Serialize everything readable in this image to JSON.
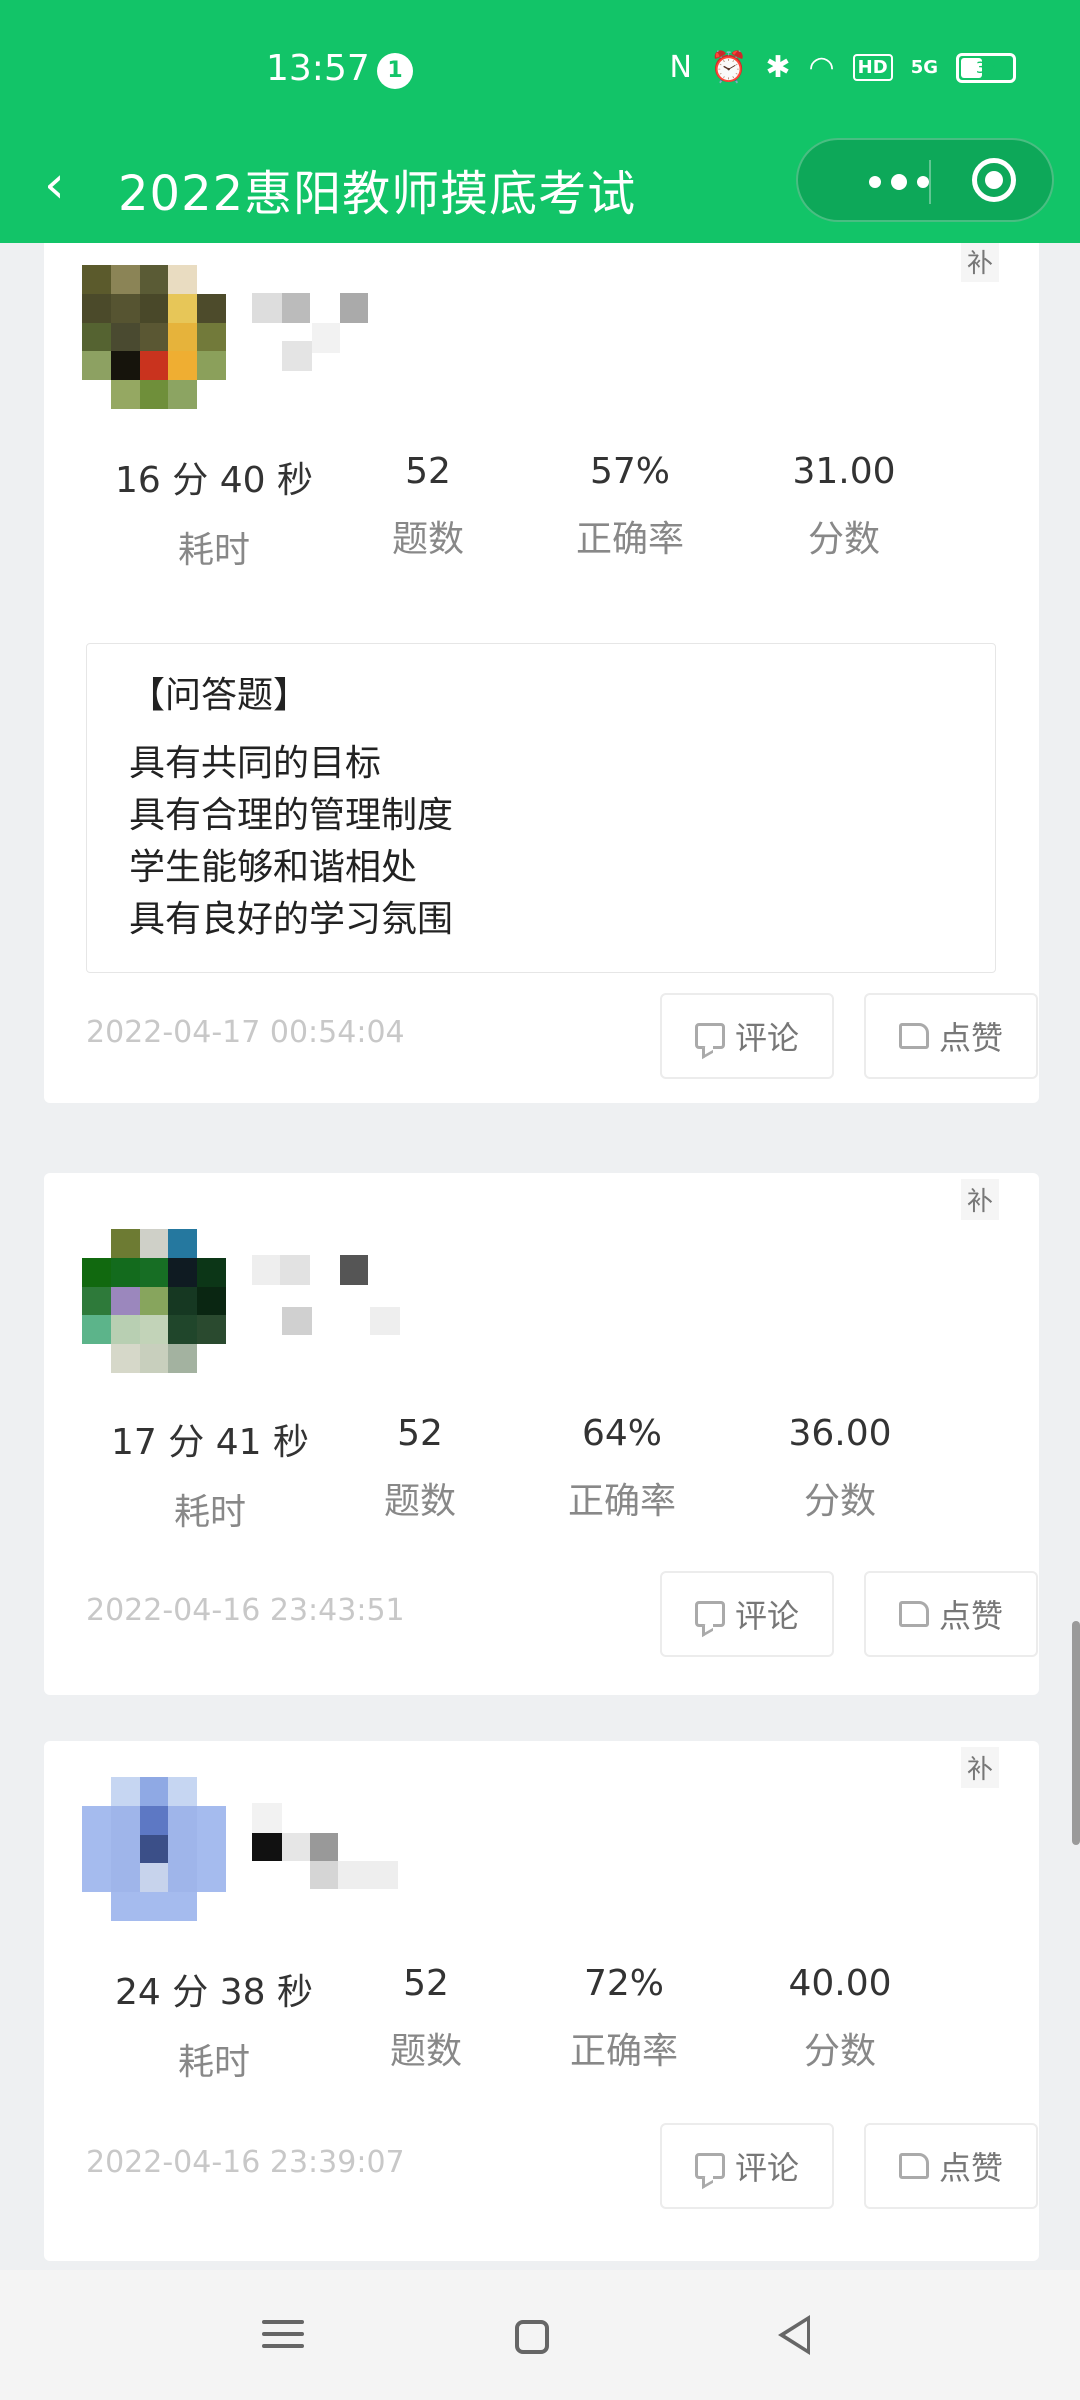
{
  "status_bar": {
    "time": "13:57",
    "notification_count": "1",
    "battery": "38",
    "network": "5G",
    "hd": "HD"
  },
  "nav": {
    "title": "2022惠阳教师摸底考试"
  },
  "labels": {
    "time_label": "耗时",
    "count_label": "题数",
    "accuracy_label": "正确率",
    "score_label": "分数",
    "comment": "评论",
    "like": "点赞",
    "tag": "补"
  },
  "records": [
    {
      "duration": "16 分 40 秒",
      "questions": "52",
      "accuracy": "57%",
      "score": "31.00",
      "answer_heading": "【问答题】",
      "answer_lines": [
        "具有共同的目标",
        "具有合理的管理制度",
        "学生能够和谐相处",
        "具有良好的学习氛围"
      ],
      "date": "2022-04-17 00:54:04"
    },
    {
      "duration": "17 分 41 秒",
      "questions": "52",
      "accuracy": "64%",
      "score": "36.00",
      "date": "2022-04-16 23:43:51"
    },
    {
      "duration": "24 分 38 秒",
      "questions": "52",
      "accuracy": "72%",
      "score": "40.00",
      "date": "2022-04-16 23:39:07"
    }
  ],
  "colors": {
    "brand_green": "#12c468"
  }
}
